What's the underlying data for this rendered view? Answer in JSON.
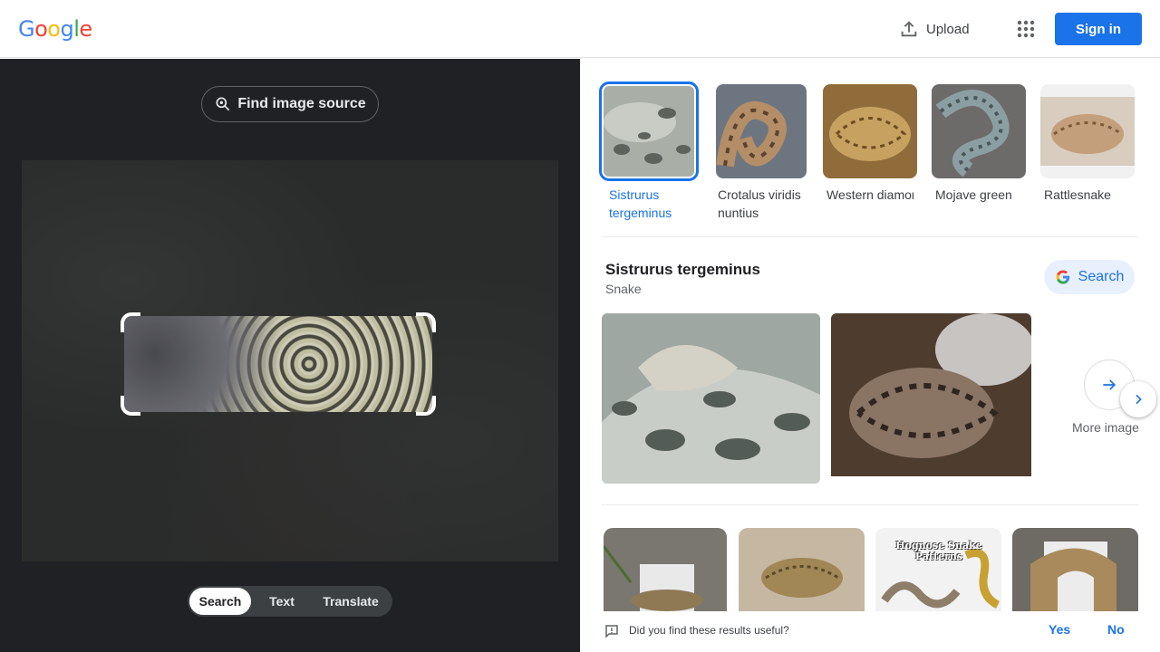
{
  "header": {
    "logo_letters": [
      "G",
      "o",
      "o",
      "g",
      "l",
      "e"
    ],
    "upload_label": "Upload",
    "signin_label": "Sign in"
  },
  "lens": {
    "find_source_label": "Find image source",
    "modes": [
      {
        "label": "Search",
        "active": true
      },
      {
        "label": "Text",
        "active": false
      },
      {
        "label": "Translate",
        "active": false
      }
    ]
  },
  "results": {
    "top_matches": [
      {
        "label": "Sistrurus tergeminus",
        "selected": true
      },
      {
        "label": "Crotalus viridis nuntius",
        "selected": false
      },
      {
        "label": "Western diamondbac...",
        "selected": false
      },
      {
        "label": "Mojave green",
        "selected": false
      },
      {
        "label": "Rattlesnake",
        "selected": false
      }
    ],
    "entity": {
      "title": "Sistrurus tergeminus",
      "subtitle": "Snake",
      "search_label": "Search",
      "more_images_label": "More image"
    },
    "grid_overlay_text": "Hognose Snake Patterns",
    "feedback": {
      "question": "Did you find these results useful?",
      "yes": "Yes",
      "no": "No"
    }
  },
  "colors": {
    "accent": "#1a73e8",
    "dark_panel": "#202124"
  }
}
